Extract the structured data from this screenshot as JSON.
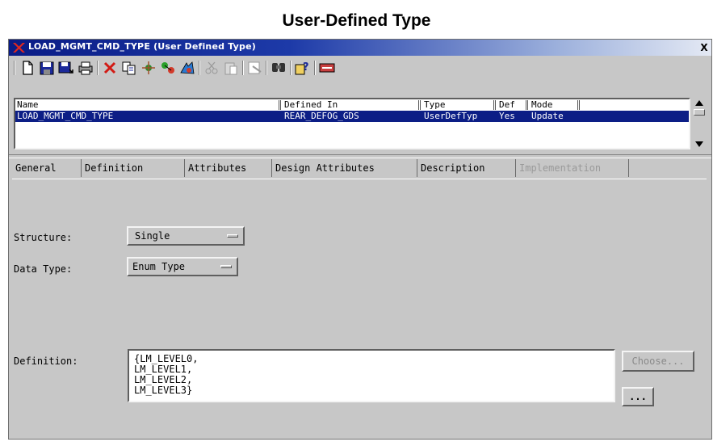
{
  "caption": "User-Defined Type",
  "window": {
    "title": "LOAD_MGMT_CMD_TYPE (User Defined Type)",
    "close_glyph": "X"
  },
  "toolbar": {
    "buttons": [
      {
        "name": "new-icon"
      },
      {
        "name": "save-icon"
      },
      {
        "name": "save-all-icon"
      },
      {
        "name": "print-icon"
      },
      {
        "name": "delete-icon"
      },
      {
        "name": "copy-icon"
      },
      {
        "name": "references-icon"
      },
      {
        "name": "relations-icon"
      },
      {
        "name": "browser-icon"
      },
      {
        "name": "cut-icon"
      },
      {
        "name": "paste-icon"
      },
      {
        "name": "locate-icon"
      },
      {
        "name": "find-icon"
      },
      {
        "name": "help-icon"
      },
      {
        "name": "settings-icon"
      }
    ]
  },
  "list": {
    "columns": [
      "Name",
      "Defined In",
      "Type",
      "Def",
      "Mode"
    ],
    "rows": [
      {
        "name": "LOAD_MGMT_CMD_TYPE",
        "defined_in": "REAR_DEFOG_GDS",
        "type": "UserDefTyp",
        "def": "Yes",
        "mode": "Update"
      }
    ]
  },
  "tabs": [
    "General",
    "Definition",
    "Attributes",
    "Design Attributes",
    "Description",
    "Implementation"
  ],
  "active_tab": "Definition",
  "form": {
    "structure_label": "Structure:",
    "structure_value": "Single",
    "datatype_label": "Data Type:",
    "datatype_value": "Enum Type",
    "definition_label": "Definition:",
    "definition_text": "{LM_LEVEL0,\nLM_LEVEL1,\nLM_LEVEL2,\nLM_LEVEL3}",
    "choose_label": "Choose...",
    "ellipsis_label": "..."
  },
  "colors": {
    "selection": "#0c1e86",
    "face": "#c7c7c7",
    "title_start": "#0a1c86"
  }
}
